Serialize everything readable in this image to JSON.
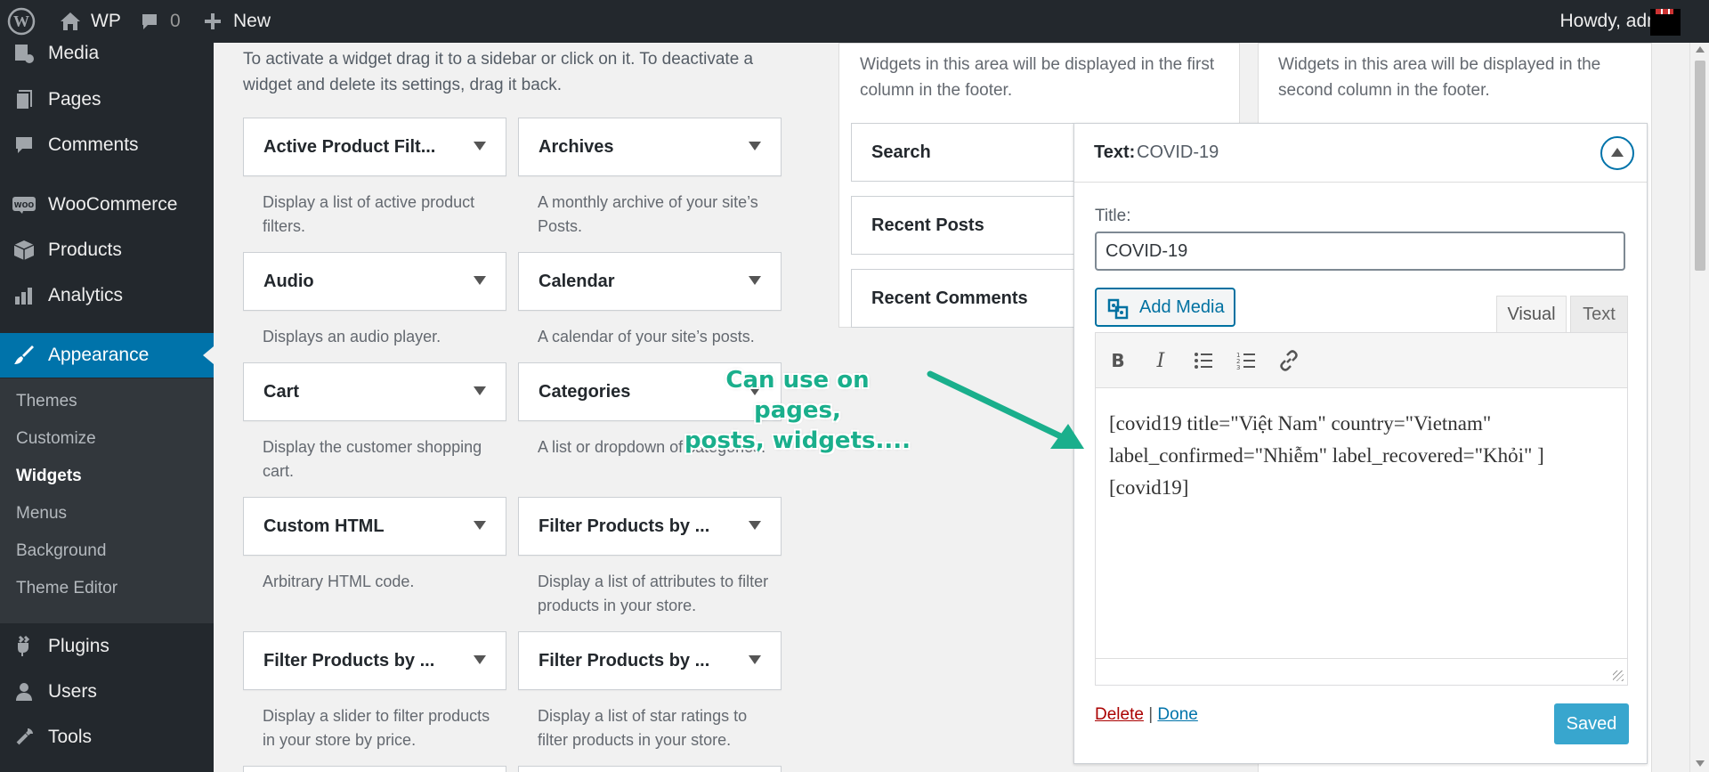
{
  "admin_bar": {
    "site_name": "WP",
    "comments_count": "0",
    "new_label": "New",
    "howdy": "Howdy, admin"
  },
  "sidebar": {
    "items": [
      {
        "label": "Media",
        "icon": "media-icon"
      },
      {
        "label": "Pages",
        "icon": "pages-icon"
      },
      {
        "label": "Comments",
        "icon": "comments-icon"
      },
      {
        "label": "WooCommerce",
        "icon": "woocommerce-icon"
      },
      {
        "label": "Products",
        "icon": "products-icon"
      },
      {
        "label": "Analytics",
        "icon": "analytics-icon"
      },
      {
        "label": "Appearance",
        "icon": "appearance-icon"
      },
      {
        "label": "Plugins",
        "icon": "plugins-icon"
      },
      {
        "label": "Users",
        "icon": "users-icon"
      },
      {
        "label": "Tools",
        "icon": "tools-icon"
      }
    ],
    "submenu": [
      "Themes",
      "Customize",
      "Widgets",
      "Menus",
      "Background",
      "Theme Editor"
    ],
    "active": "Appearance",
    "current_sub": "Widgets"
  },
  "available_widgets": {
    "intro": "To activate a widget drag it to a sidebar or click on it. To deactivate a widget and delete its settings, drag it back.",
    "widgets": [
      {
        "title": "Active Product Filt...",
        "desc": "Display a list of active product filters."
      },
      {
        "title": "Archives",
        "desc": "A monthly archive of your site’s Posts."
      },
      {
        "title": "Audio",
        "desc": "Displays an audio player."
      },
      {
        "title": "Calendar",
        "desc": "A calendar of your site’s posts."
      },
      {
        "title": "Cart",
        "desc": "Display the customer shopping cart."
      },
      {
        "title": "Categories",
        "desc": "A list or dropdown of categories."
      },
      {
        "title": "Custom HTML",
        "desc": "Arbitrary HTML code."
      },
      {
        "title": "Filter Products by ...",
        "desc": "Display a list of attributes to filter products in your store."
      },
      {
        "title": "Filter Products by ...",
        "desc": "Display a slider to filter products in your store by price."
      },
      {
        "title": "Filter Products by ...",
        "desc": "Display a list of star ratings to filter products in your store."
      }
    ]
  },
  "footer_areas": {
    "col1_desc": "Widgets in this area will be displayed in the first column in the footer.",
    "col2_desc": "Widgets in this area will be displayed in the second column in the footer.",
    "col1_widgets": [
      "Search",
      "Recent Posts",
      "Recent Comments"
    ]
  },
  "text_widget": {
    "head_type": "Text:",
    "head_title": "COVID-19",
    "title_label": "Title:",
    "title_value": "COVID-19",
    "add_media": "Add Media",
    "tab_visual": "Visual",
    "tab_text": "Text",
    "content_line1": "[covid19 title=\"Việt Nam\" country=\"Vietnam\"",
    "content_line2": "label_confirmed=\"Nhiễm\" label_recovered=\"Khỏi\" ]",
    "content_line3": "[covid19]",
    "delete": "Delete",
    "separator": "|",
    "done": "Done",
    "saved": "Saved"
  },
  "annotation": {
    "line1": "Can use on pages,",
    "line2": "posts, widgets....",
    "color": "#1aaf8c"
  },
  "colors": {
    "admin_bg": "#23282d",
    "accent": "#0073aa",
    "saved_button": "#2ea2cc"
  }
}
